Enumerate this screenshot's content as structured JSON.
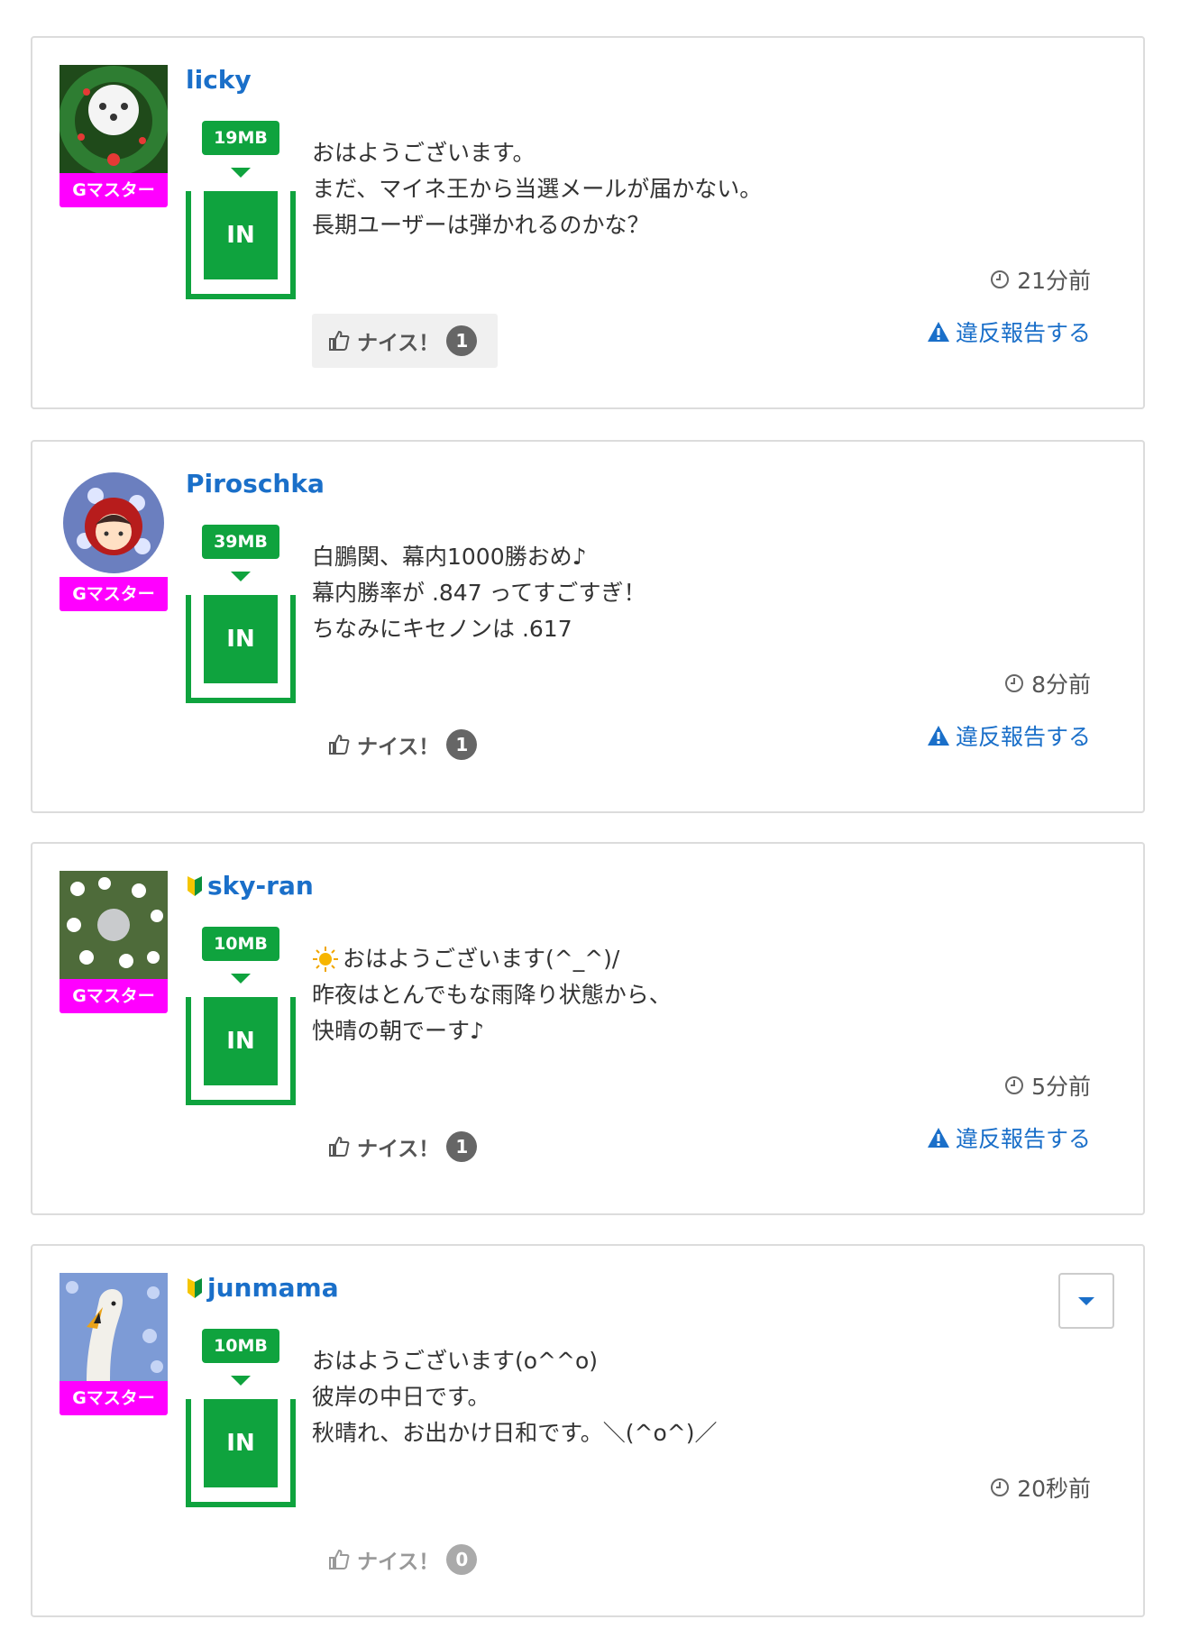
{
  "colors": {
    "link": "#1a6fc9",
    "meter_green": "#0fa33e",
    "rank_magenta": "#ff00ff",
    "border": "#dcdcdc"
  },
  "posts": [
    {
      "username": "licky",
      "beginner_mark": false,
      "rank": "Gマスター",
      "data_balance": "19MB",
      "meter_label": "IN",
      "message_lines": [
        "おはようございます。",
        "まだ、マイネ王から当選メールが届かない。",
        "長期ユーザーは弾かれるのかな？"
      ],
      "time": "21分前",
      "report_label": "違反報告する",
      "nice_label": "ナイス！",
      "nice_count": "1",
      "nice_active": true,
      "avatar_icon": "poodle-wreath-avatar"
    },
    {
      "username": "Piroschka",
      "beginner_mark": false,
      "rank": "Gマスター",
      "data_balance": "39MB",
      "meter_label": "IN",
      "message_lines": [
        "白鵬関、幕内1000勝おめ♪",
        "幕内勝率が .847 ってすごすぎ！",
        "ちなみにキセノンは .617"
      ],
      "time": "8分前",
      "report_label": "違反報告する",
      "nice_label": "ナイス！",
      "nice_count": "1",
      "nice_active": false,
      "avatar_icon": "red-hood-avatar"
    },
    {
      "username": "sky-ran",
      "beginner_mark": true,
      "rank": "Gマスター",
      "data_balance": "10MB",
      "meter_label": "IN",
      "message_lines": [
        "おはようございます(^_^)/",
        "昨夜はとんでもな雨降り状態から、",
        "快晴の朝でーす♪"
      ],
      "message_icon": "sun-icon",
      "time": "5分前",
      "report_label": "違反報告する",
      "nice_label": "ナイス！",
      "nice_count": "1",
      "nice_active": false,
      "avatar_icon": "flower-field-avatar"
    },
    {
      "username": "junmama",
      "beginner_mark": true,
      "rank": "Gマスター",
      "data_balance": "10MB",
      "meter_label": "IN",
      "message_lines": [
        "おはようございます(o^^o)",
        "彼岸の中日です。",
        "秋晴れ、お出かけ日和です。＼(^o^)／"
      ],
      "time": "20秒前",
      "nice_label": "ナイス！",
      "nice_count": "0",
      "nice_active": false,
      "has_dropdown": true,
      "avatar_icon": "swan-flowers-avatar"
    }
  ]
}
